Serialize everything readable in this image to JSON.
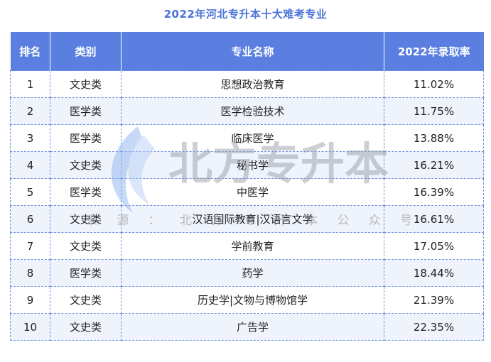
{
  "title": "2022年河北专升本十大难考专业",
  "headers": [
    "排名",
    "类别",
    "专业名称",
    "2022年录取率"
  ],
  "rows": [
    [
      "1",
      "文史类",
      "思想政治教育",
      "11.02%"
    ],
    [
      "2",
      "医学类",
      "医学检验技术",
      "11.75%"
    ],
    [
      "3",
      "医学类",
      "临床医学",
      "13.88%"
    ],
    [
      "4",
      "文史类",
      "秘书学",
      "16.21%"
    ],
    [
      "5",
      "医学类",
      "中医学",
      "16.39%"
    ],
    [
      "6",
      "文史类",
      "汉语国际教育|汉语言文学",
      "16.61%"
    ],
    [
      "7",
      "文史类",
      "学前教育",
      "17.05%"
    ],
    [
      "8",
      "医学类",
      "药学",
      "18.44%"
    ],
    [
      "9",
      "文史类",
      "历史学|文物与博物馆学",
      "21.39%"
    ],
    [
      "10",
      "文史类",
      "广告学",
      "22.35%"
    ]
  ],
  "watermark": {
    "logo_text": "北方专升本",
    "source_chars": [
      "来",
      "源",
      "：",
      "北",
      "方",
      "专",
      "升",
      "本",
      "公",
      "众",
      "号"
    ]
  },
  "colors": {
    "title": "#4a72d8",
    "header_bg": "#5b7fe0",
    "stripe": "#eef3fc",
    "border": "#6f8fe0"
  }
}
